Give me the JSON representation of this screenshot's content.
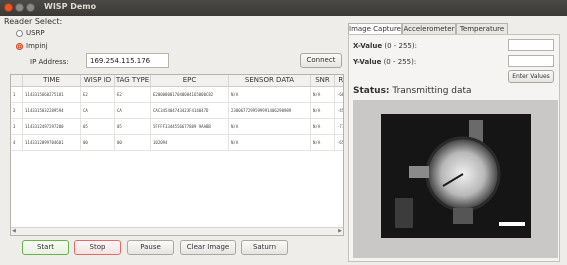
{
  "window": {
    "title": "WISP Demo"
  },
  "reader": {
    "section_label": "Reader Select:",
    "option_usrp": "USRP",
    "option_impinj": "Impinj",
    "ip_label": "IP Address:",
    "ip_value": "169.254.115.176",
    "connect_label": "Connect"
  },
  "table": {
    "columns": [
      "TIME",
      "WISP ID",
      "TAG TYPE",
      "EPC",
      "SENSOR DATA",
      "SNR",
      "RS"
    ],
    "rows": [
      {
        "num": "1",
        "time": "1143315660275181",
        "wisp": "E2",
        "tagtype": "E2",
        "epc": "E200000017040084165000C82",
        "sensor": "N/A",
        "snr": "N/A",
        "rs": "-66"
      },
      {
        "num": "2",
        "time": "1143315832289594",
        "wisp": "CA",
        "tagtype": "CA",
        "epc": "CAC345404743423F414047D",
        "sensor": "2380677299599991406290989",
        "snr": "N/A",
        "rs": "-45"
      },
      {
        "num": "3",
        "time": "1143312497297200",
        "wisp": "05",
        "tagtype": "05",
        "epc": "5FFFF3344556677889 9AABB",
        "sensor": "N/A",
        "snr": "N/A",
        "rs": "-71"
      },
      {
        "num": "4",
        "time": "1143312899704601",
        "wisp": "00",
        "tagtype": "00",
        "epc": "102094",
        "sensor": "N/A",
        "snr": "N/A",
        "rs": "-65"
      }
    ]
  },
  "controls": {
    "start": "Start",
    "stop": "Stop",
    "pause": "Pause",
    "clear_image": "Clear Image",
    "saturn": "Saturn"
  },
  "tabs": {
    "image_capture": "Image Capture",
    "accelerometer": "Accelerometer",
    "temperature": "Temperature"
  },
  "capture": {
    "x_label_bold": "X-Value",
    "x_label_range": "(0 - 255):",
    "y_label_bold": "Y-Value",
    "y_label_range": "(0 - 255):",
    "enter_values": "Enter Values",
    "status_bold": "Status:",
    "status_text": "Transmitting data"
  },
  "colors": {
    "accent": "#e95420",
    "start_border": "#6ab04c",
    "stop_border": "#e06b6b"
  }
}
